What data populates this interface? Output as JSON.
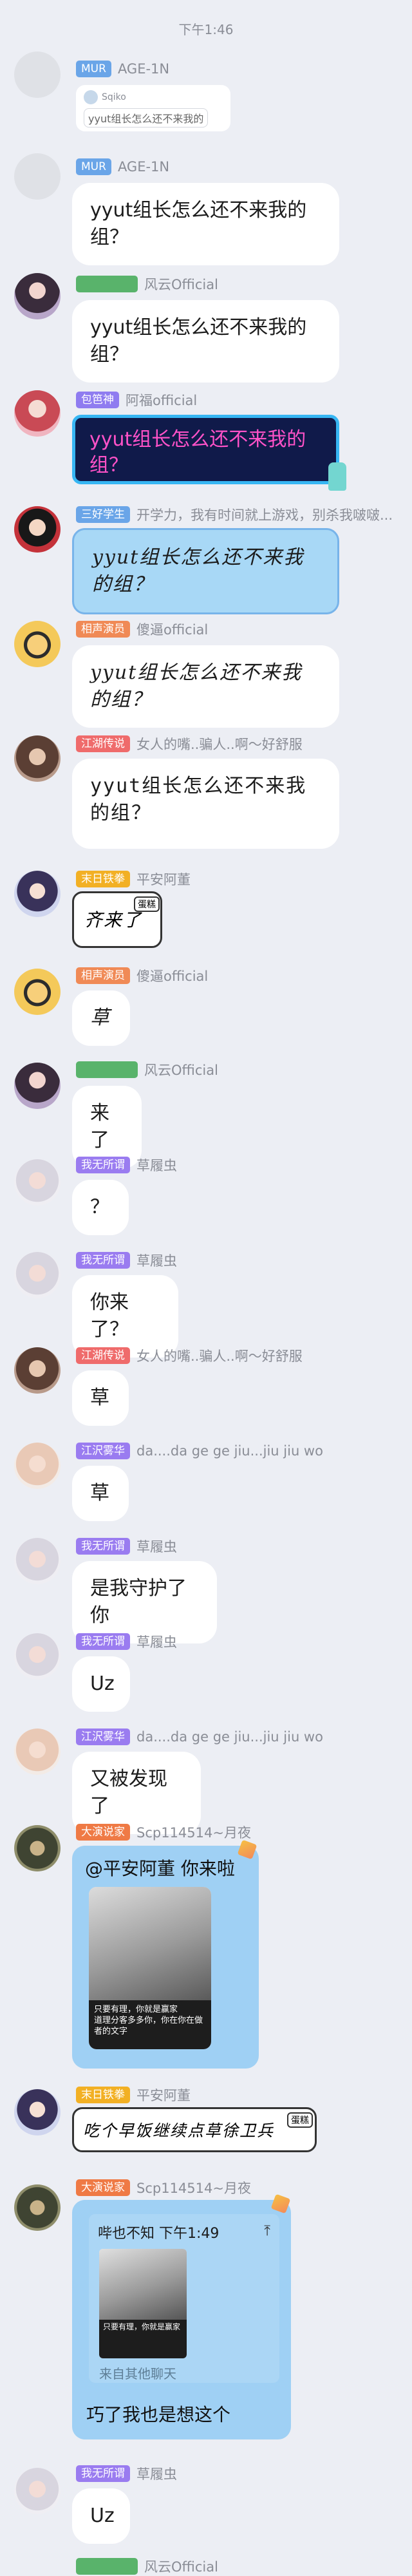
{
  "status": {
    "time": "下午1:46"
  },
  "colors": {
    "background": "#eceef4",
    "bubble": "#ffffff",
    "blue_card": "#9fd0f4"
  },
  "messages": [
    {
      "badge": "MUR",
      "name": "AGE-1N",
      "reply_name": "Sqiko",
      "reply_text": "yyut组长怎么还不来我的"
    },
    {
      "badge": "MUR",
      "name": "AGE-1N",
      "text": "yyut组长怎么还不来我的组？"
    },
    {
      "badge": "",
      "name": "风云Official",
      "text": "yyut组长怎么还不来我的组？"
    },
    {
      "badge": "包笆神",
      "name": "阿福official",
      "text": "yyut组长怎么还不来我的组？"
    },
    {
      "badge": "三好学生",
      "name": "开学力，我有时间就上游戏，别杀我啵啵...",
      "text": "yyut组长怎么还不来我的组？"
    },
    {
      "badge": "相声演员",
      "name": "傻逼official",
      "text": "yyut组长怎么还不来我的组？"
    },
    {
      "badge": "江湖传说",
      "name": "女人的嘴..骗人..啊～好舒服",
      "text": "yyut组长怎么还不来我的组？"
    },
    {
      "badge": "末日铁拳",
      "name": "平安阿董",
      "text": "齐来了",
      "tag": "蛋糕"
    },
    {
      "badge": "相声演员",
      "name": "傻逼official",
      "text": "草"
    },
    {
      "badge": "",
      "name": "风云Official",
      "text": "来了"
    },
    {
      "badge": "我无所谓",
      "name": "草履虫",
      "text": "？"
    },
    {
      "badge": "我无所谓",
      "name": "草履虫",
      "text": "你来了？"
    },
    {
      "badge": "江湖传说",
      "name": "女人的嘴..骗人..啊～好舒服",
      "text": "草"
    },
    {
      "badge": "江沢雾华",
      "name": "da....da ge ge jiu...jiu jiu wo",
      "text": "草"
    },
    {
      "badge": "我无所谓",
      "name": "草履虫",
      "text": "是我守护了你"
    },
    {
      "badge": "我无所谓",
      "name": "草履虫",
      "text": "Uz"
    },
    {
      "badge": "江沢雾华",
      "name": "da....da ge ge jiu...jiu jiu wo",
      "text": "又被发现了"
    },
    {
      "badge": "大演说家",
      "name": "Scp114514~月夜",
      "text": "@平安阿董 你来啦",
      "img_caption": "只要有理，你就是赢家\n道理分客多多你，你在你在做者的文字"
    },
    {
      "badge": "末日铁拳",
      "name": "平安阿董",
      "text": "吃个早饭继续点草徐卫兵",
      "tag": "蛋糕"
    },
    {
      "badge": "大演说家",
      "name": "Scp114514~月夜",
      "forward_title": "哔也不知 下午1:49",
      "forward_footer": "来自其他聊天",
      "text": "巧了我也是想这个",
      "img_caption": "只要有理，你就是赢家"
    },
    {
      "badge": "我无所谓",
      "name": "草履虫",
      "text": "Uz"
    },
    {
      "badge": "",
      "name": "风云Official"
    }
  ]
}
